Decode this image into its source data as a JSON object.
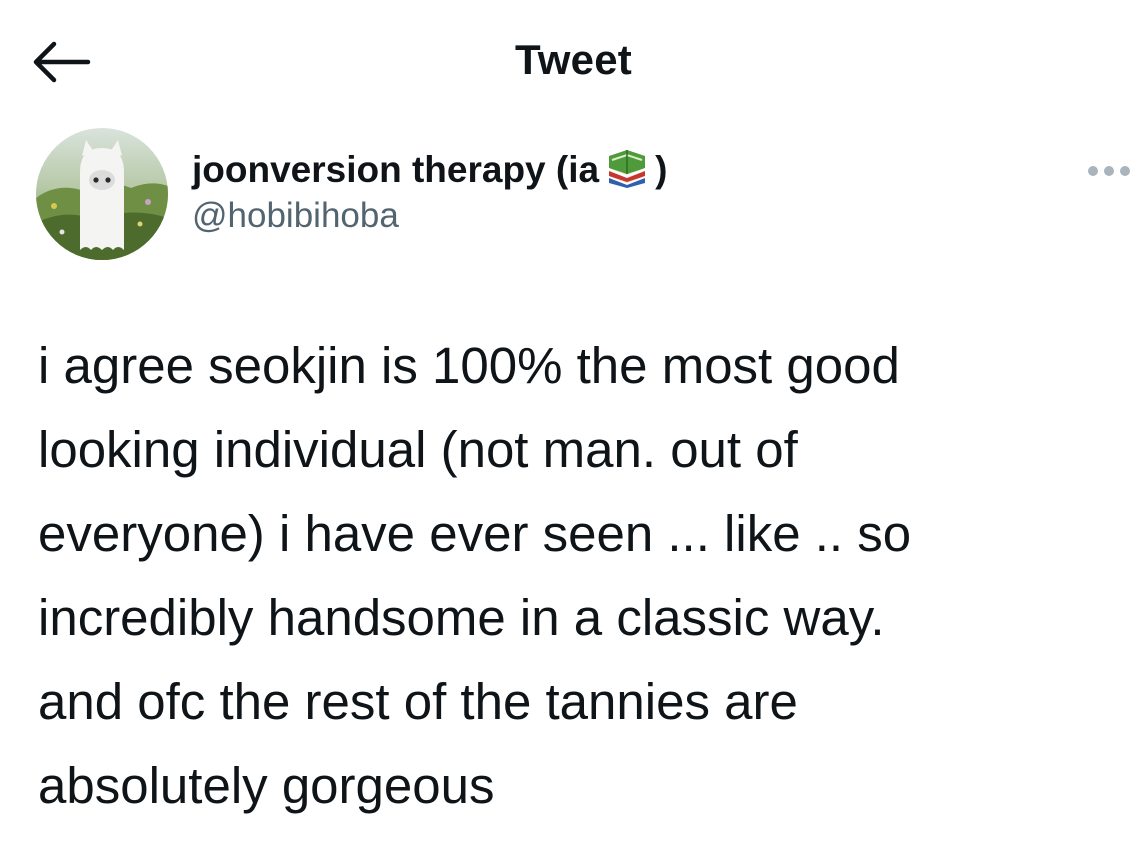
{
  "header": {
    "title": "Tweet",
    "back_icon": "arrow-left-icon"
  },
  "author": {
    "display_name_prefix": "joonversion therapy (ia",
    "display_name_emoji": "books-emoji",
    "display_name_suffix": ")",
    "handle": "@hobibihoba",
    "avatar": "ghost-avatar",
    "more_icon": "more-horizontal-icon"
  },
  "tweet": {
    "text": "i agree seokjin is 100% the most good\nlooking individual (not man. out of\neveryone) i have ever seen ... like .. so\nincredibly handsome in a classic way.\nand ofc the rest of the tannies are\nabsolutely gorgeous"
  },
  "colors": {
    "text_primary": "#0f1419",
    "text_secondary": "#536471",
    "background": "#ffffff"
  }
}
